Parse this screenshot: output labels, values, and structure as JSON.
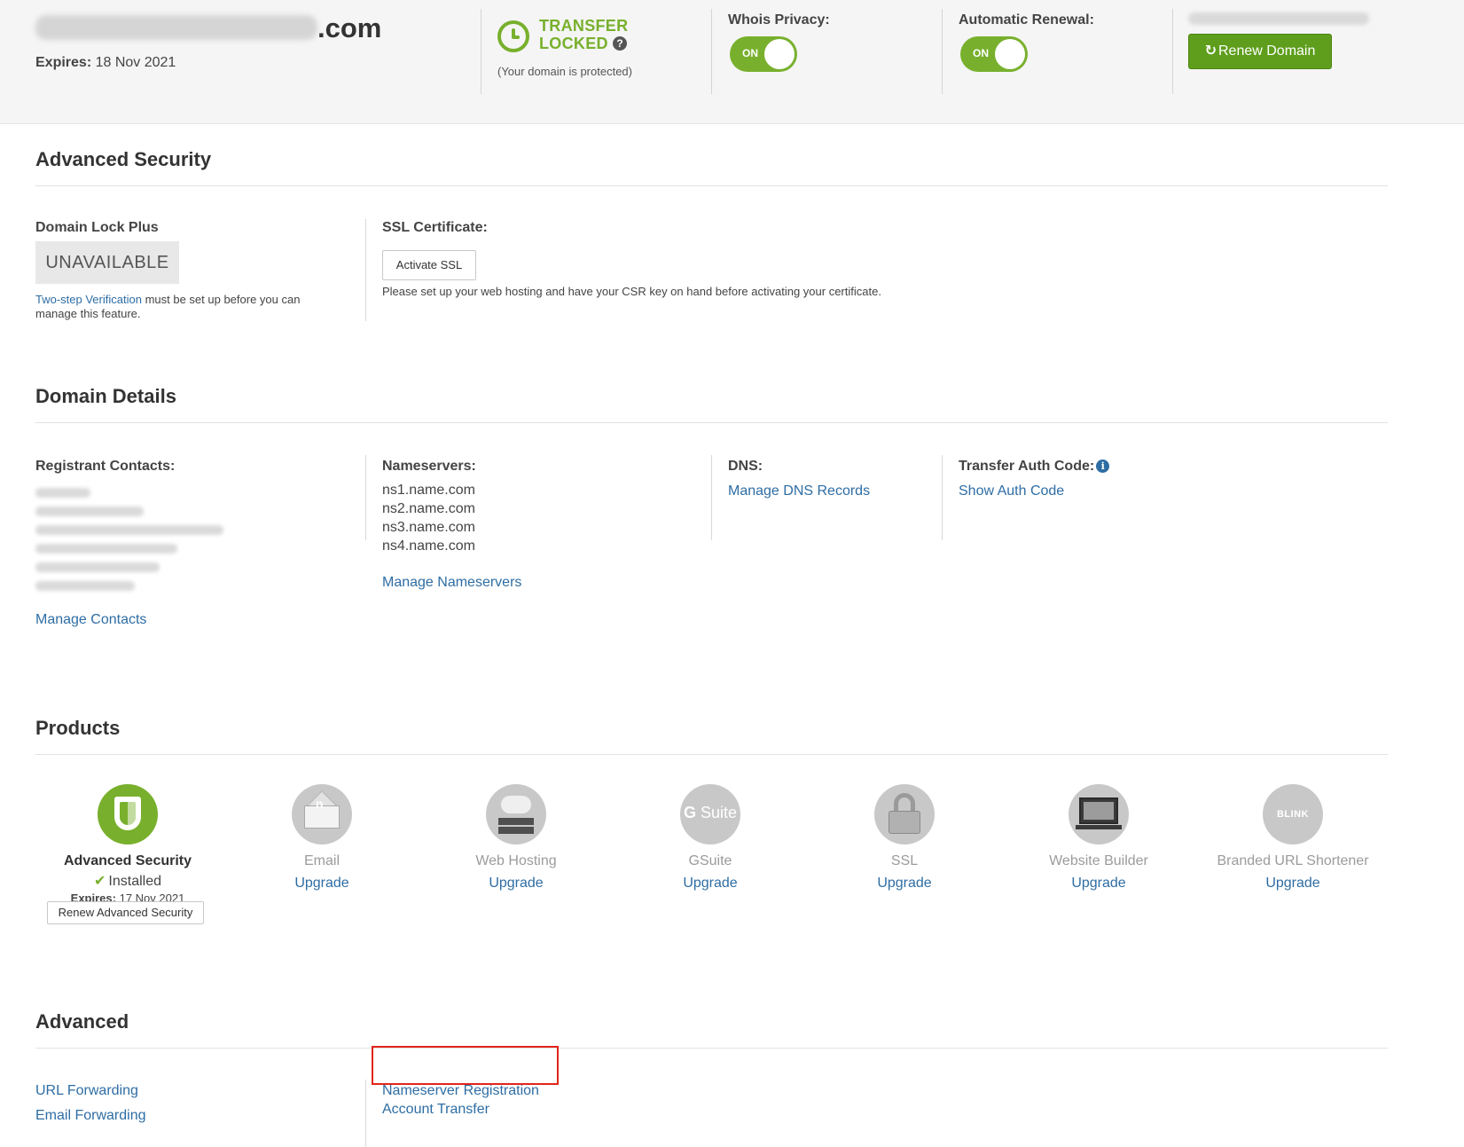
{
  "header": {
    "domain_suffix": ".com",
    "expires_label": "Expires:",
    "expires_value": "18 Nov 2021",
    "transfer_line1": "TRANSFER",
    "transfer_line2": "LOCKED",
    "transfer_help_glyph": "?",
    "transfer_note": "(Your domain is protected)",
    "whois_label": "Whois Privacy:",
    "whois_toggle": "ON",
    "renewal_label": "Automatic Renewal:",
    "renewal_toggle": "ON",
    "renew_button": "Renew Domain",
    "renew_icon": "refresh-icon"
  },
  "advanced_security": {
    "title": "Advanced Security",
    "domain_lock_label": "Domain Lock Plus",
    "domain_lock_status": "UNAVAILABLE",
    "two_step_link": "Two-step Verification",
    "two_step_note_l1": " must be set up before you can",
    "two_step_note_l2": "manage this feature.",
    "ssl_label": "SSL Certificate:",
    "activate_ssl_button": "Activate SSL",
    "ssl_note": "Please set up your web hosting and have your CSR key on hand before activating your certificate."
  },
  "domain_details": {
    "title": "Domain Details",
    "registrant_label": "Registrant Contacts:",
    "manage_contacts": "Manage Contacts",
    "nameservers_label": "Nameservers:",
    "nameservers": [
      "ns1.name.com",
      "ns2.name.com",
      "ns3.name.com",
      "ns4.name.com"
    ],
    "manage_nameservers": "Manage Nameservers",
    "dns_label": "DNS:",
    "manage_dns": "Manage DNS Records",
    "auth_label": "Transfer Auth Code:",
    "show_auth": "Show Auth Code"
  },
  "products": {
    "title": "Products",
    "items": [
      {
        "name": "Advanced Security",
        "status": "Installed",
        "expires_label": "Expires:",
        "expires": "17 Nov 2021",
        "action": "Renew Advanced Security",
        "icon": "shield-icon"
      },
      {
        "name": "Email",
        "action": "Upgrade",
        "icon": "email-icon"
      },
      {
        "name": "Web Hosting",
        "action": "Upgrade",
        "icon": "web-hosting-icon"
      },
      {
        "name": "GSuite",
        "action": "Upgrade",
        "icon": "gsuite-icon",
        "icon_text_a": "G",
        "icon_text_b": "Suite"
      },
      {
        "name": "SSL",
        "action": "Upgrade",
        "icon": "ssl-padlock-icon"
      },
      {
        "name": "Website Builder",
        "action": "Upgrade",
        "icon": "website-builder-icon"
      },
      {
        "name": "Branded URL Shortener",
        "action": "Upgrade",
        "icon": "blink-icon",
        "icon_text": "BLINK"
      }
    ]
  },
  "advanced": {
    "title": "Advanced",
    "url_forwarding": "URL Forwarding",
    "email_forwarding": "Email Forwarding",
    "nameserver_registration": "Nameserver Registration",
    "account_transfer": "Account Transfer"
  },
  "colors": {
    "accent_green": "#78b02d",
    "renew_green": "#5e9e1c",
    "link_blue": "#2e6da4",
    "highlight_red": "#e1251b"
  }
}
